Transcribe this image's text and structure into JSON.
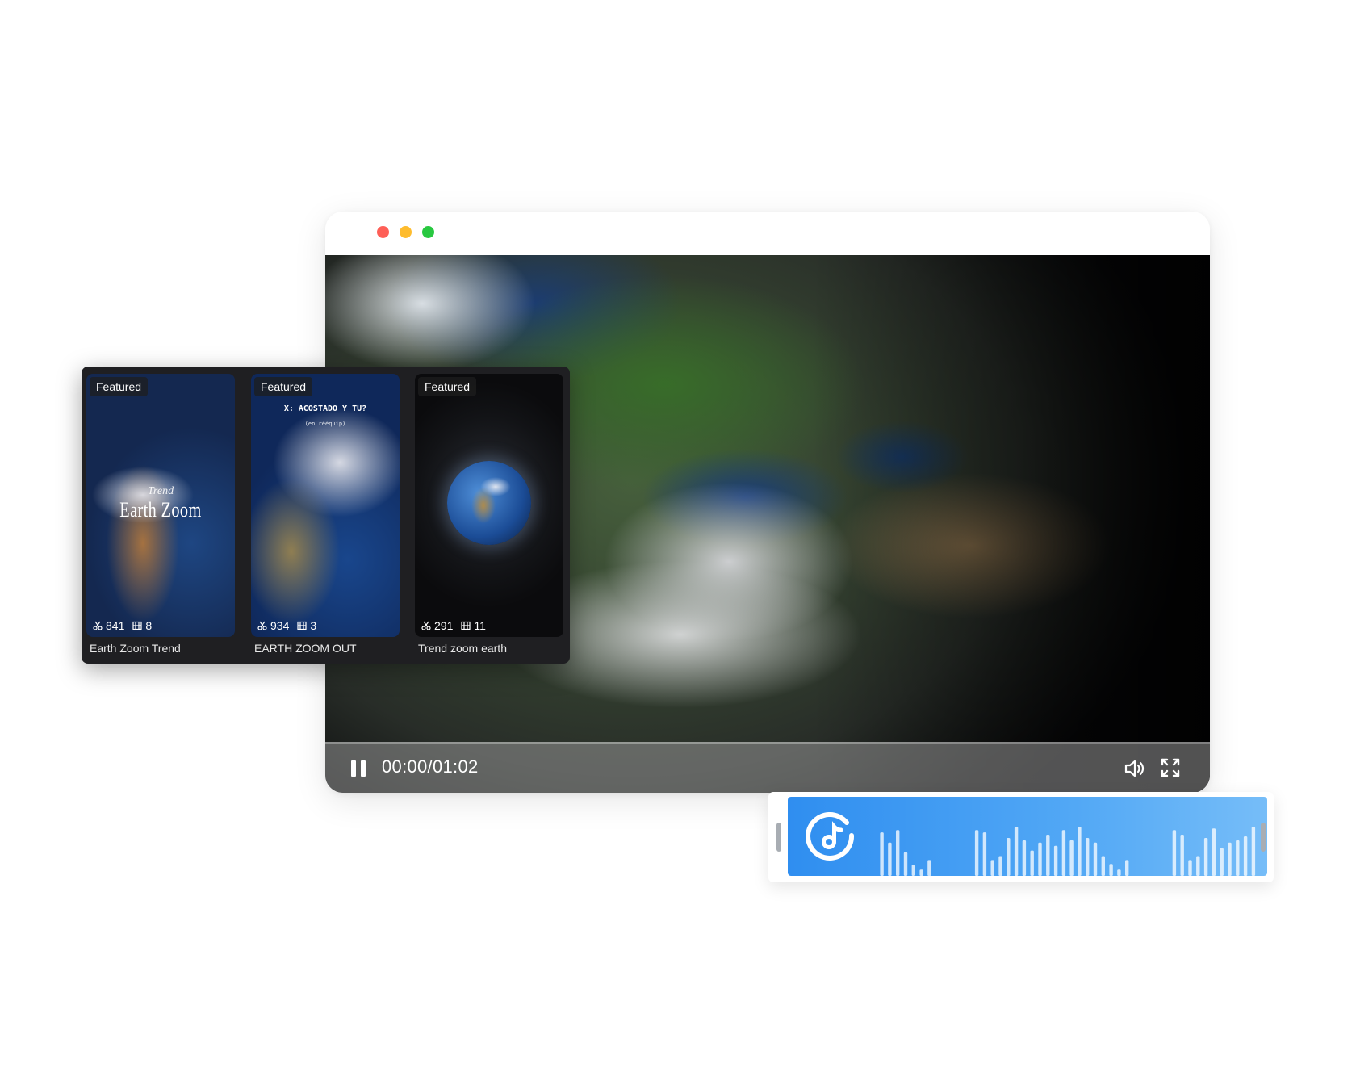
{
  "player": {
    "current_time": "00:00",
    "duration": "01:02",
    "time_label": "00:00/01:02",
    "progress": 0
  },
  "templates": [
    {
      "badge": "Featured",
      "uses": "841",
      "clips": "8",
      "title": "Earth Zoom Trend",
      "overlay_small": "Trend",
      "overlay_big": "Earth Zoom"
    },
    {
      "badge": "Featured",
      "uses": "934",
      "clips": "3",
      "title": "EARTH ZOOM OUT",
      "overlay_line1": "X: ACOSTADO Y TU?",
      "overlay_line2": "(en rééquip)"
    },
    {
      "badge": "Featured",
      "uses": "291",
      "clips": "11",
      "title": "Trend zoom earth"
    }
  ],
  "icons": {
    "window_controls": [
      "close-dot",
      "minimize-dot",
      "maximize-dot"
    ],
    "pause": "pause-icon",
    "volume": "volume-icon",
    "fullscreen": "fullscreen-icon",
    "uses": "scissors-icon",
    "clips": "film-icon",
    "music": "music-note-icon"
  },
  "colors": {
    "close": "#fe5f57",
    "minimize": "#febc2e",
    "maximize": "#28c840",
    "audio_start": "#2f8ef0",
    "audio_end": "#76bdf8",
    "panel_bg": "#1f1f22"
  },
  "audio": {
    "waveform": [
      0.55,
      0.42,
      0.58,
      0.3,
      0.14,
      0.08,
      0.2,
      0,
      0,
      0,
      0,
      0,
      0.58,
      0.55,
      0.2,
      0.25,
      0.48,
      0.62,
      0.45,
      0.32,
      0.42,
      0.52,
      0.38,
      0.58,
      0.45,
      0.62,
      0.48,
      0.42,
      0.25,
      0.15,
      0.08,
      0.2,
      0,
      0,
      0,
      0,
      0,
      0.58,
      0.52,
      0.2,
      0.25,
      0.48,
      0.6,
      0.35,
      0.42,
      0.45,
      0.5,
      0.62
    ]
  }
}
